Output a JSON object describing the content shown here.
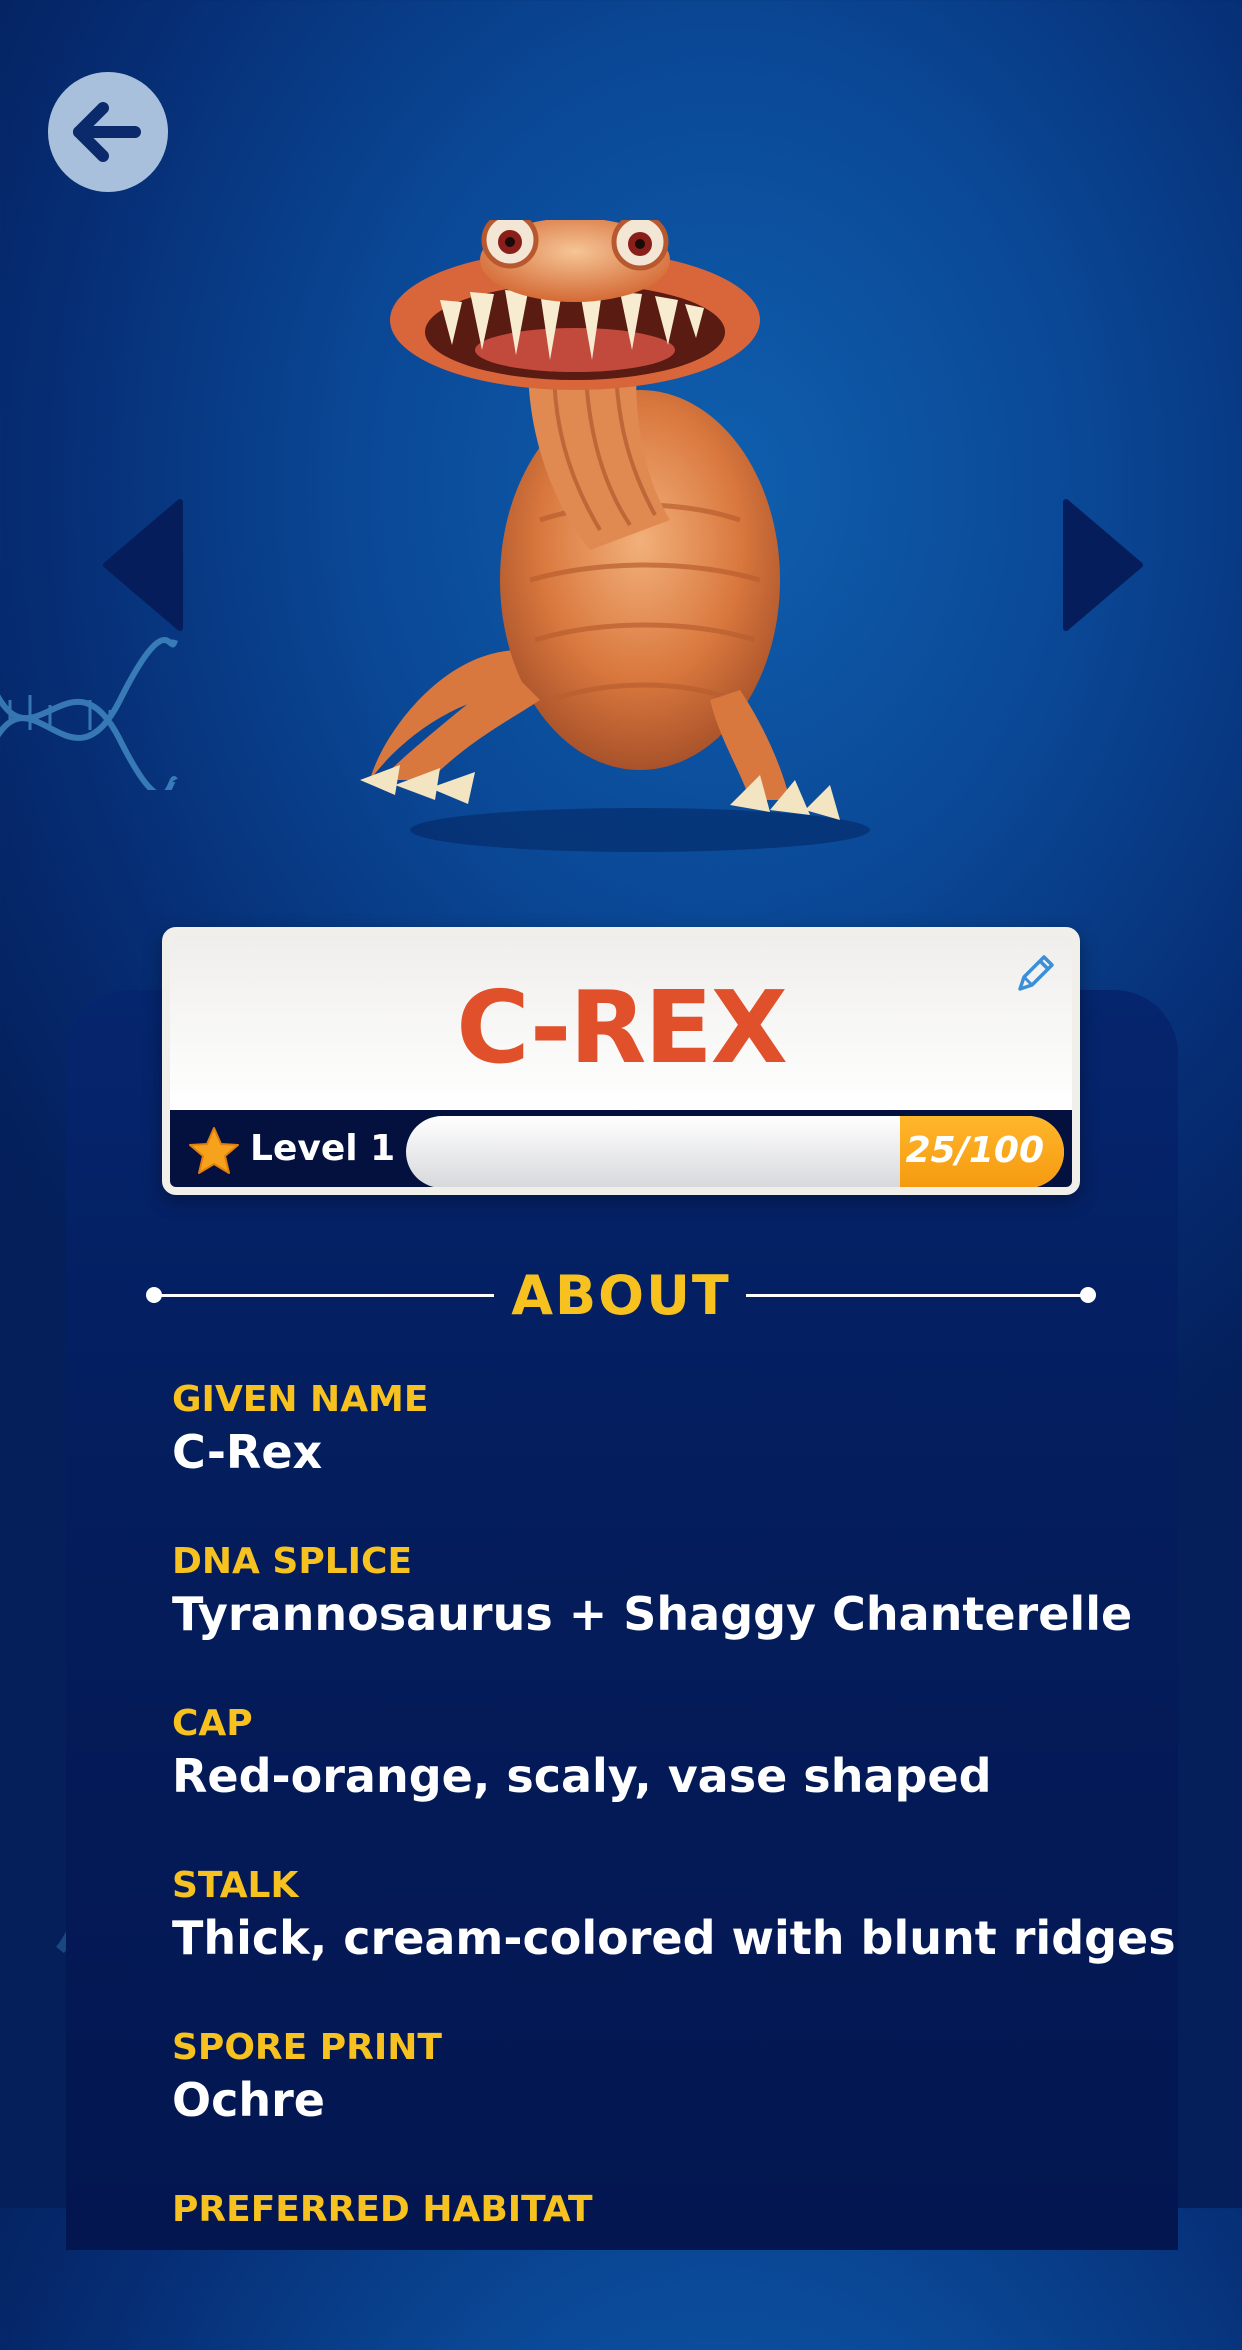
{
  "creature": {
    "name": "C-REX"
  },
  "level": {
    "label": "Level 1",
    "xp_current": 25,
    "xp_max": 100,
    "xp_text": "25/100"
  },
  "about": {
    "title": "ABOUT",
    "fields": [
      {
        "label": "GIVEN NAME",
        "value": "C-Rex"
      },
      {
        "label": "DNA SPLICE",
        "value": "Tyrannosaurus + Shaggy Chanterelle"
      },
      {
        "label": "CAP",
        "value": "Red-orange, scaly, vase shaped"
      },
      {
        "label": "STALK",
        "value": "Thick, cream-colored with blunt ridges"
      },
      {
        "label": "SPORE PRINT",
        "value": "Ochre"
      },
      {
        "label": "PREFERRED HABITAT",
        "value": ""
      }
    ]
  },
  "icons": {
    "back": "back-arrow-icon",
    "edit": "pencil-icon",
    "star": "star-icon",
    "prev": "triangle-left-icon",
    "next": "triangle-right-icon"
  },
  "colors": {
    "accent_yellow": "#f7c21f",
    "name_red": "#e0502a",
    "xp_orange": "#f59a10",
    "background_blue": "#0a4896"
  }
}
